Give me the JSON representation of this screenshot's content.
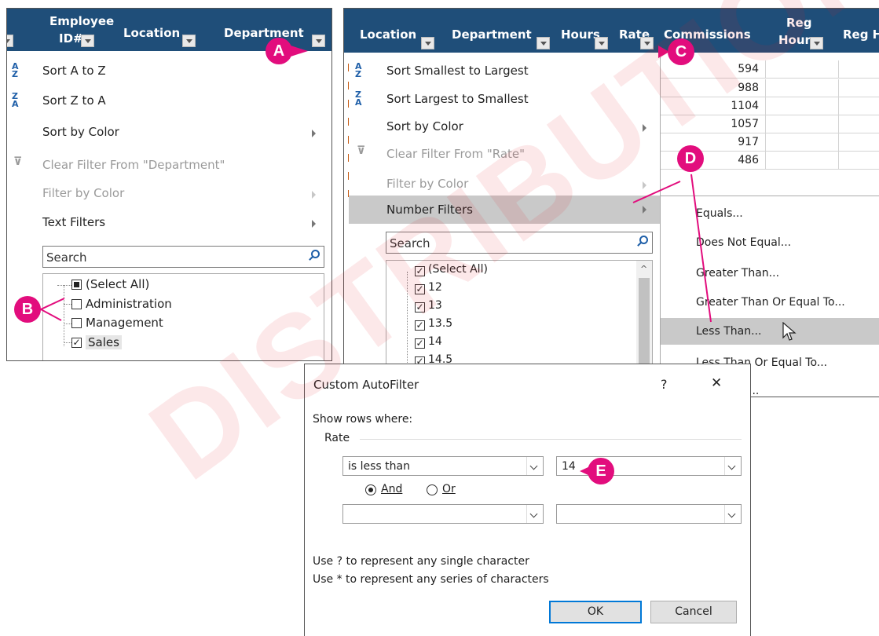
{
  "panel_left": {
    "headers": [
      "Employee",
      "ID#",
      "Location",
      "Department"
    ],
    "menu": [
      {
        "label": "Sort A to Z",
        "enabled": true
      },
      {
        "label": "Sort Z to A",
        "enabled": true
      },
      {
        "label": "Sort by Color",
        "enabled": true
      },
      {
        "label": "Clear Filter From \"Department\"",
        "enabled": false
      },
      {
        "label": "Filter by Color",
        "enabled": false
      },
      {
        "label": "Text Filters",
        "enabled": true
      }
    ],
    "search_placeholder": "Search",
    "items": [
      {
        "label": "(Select All)",
        "state": "partial"
      },
      {
        "label": "Administration",
        "state": "unchecked"
      },
      {
        "label": "Management",
        "state": "unchecked"
      },
      {
        "label": "Sales",
        "state": "checked"
      }
    ]
  },
  "panel_right": {
    "headers": [
      "Location",
      "Department",
      "Hours",
      "Rate",
      "Commissions",
      "Reg",
      "Hours",
      "Reg H"
    ],
    "menu": [
      {
        "label": "Sort Smallest to Largest",
        "enabled": true
      },
      {
        "label": "Sort Largest to Smallest",
        "enabled": true
      },
      {
        "label": "Sort by Color",
        "enabled": true
      },
      {
        "label": "Clear Filter From \"Rate\"",
        "enabled": false
      },
      {
        "label": "Filter by Color",
        "enabled": false
      },
      {
        "label": "Number Filters",
        "enabled": true
      }
    ],
    "search_placeholder": "Search",
    "items": [
      {
        "label": "(Select All)",
        "state": "checked"
      },
      {
        "label": "12",
        "state": "checked"
      },
      {
        "label": "13",
        "state": "checked"
      },
      {
        "label": "13.5",
        "state": "checked"
      },
      {
        "label": "14",
        "state": "checked"
      },
      {
        "label": "14.5",
        "state": "checked"
      }
    ],
    "commission_values": [
      "594",
      "988",
      "1104",
      "1057",
      "917",
      "486"
    ],
    "submenu": [
      "Equals...",
      "Does Not Equal...",
      "Greater Than...",
      "Greater Than Or Equal To...",
      "Less Than...",
      "Less Than Or Equal To...",
      "..."
    ]
  },
  "dialog": {
    "title": "Custom AutoFilter",
    "help_glyph": "?",
    "close_glyph": "✕",
    "show_rows": "Show rows where:",
    "field": "Rate",
    "operator1": "is less than",
    "value1": "14",
    "and_label": "And",
    "or_label": "Or",
    "operator2": "",
    "value2": "",
    "hint1": "Use ? to represent any single character",
    "hint2": "Use * to represent any series of characters",
    "ok": "OK",
    "cancel": "Cancel"
  },
  "callouts": [
    "A",
    "B",
    "C",
    "D",
    "E"
  ],
  "watermark": "DISTRIBUTION ONLY",
  "colors": {
    "header": "#1f4e79",
    "callout": "#e20d7d",
    "highlight": "#c9c9c9",
    "default_button": "#0078d7"
  }
}
